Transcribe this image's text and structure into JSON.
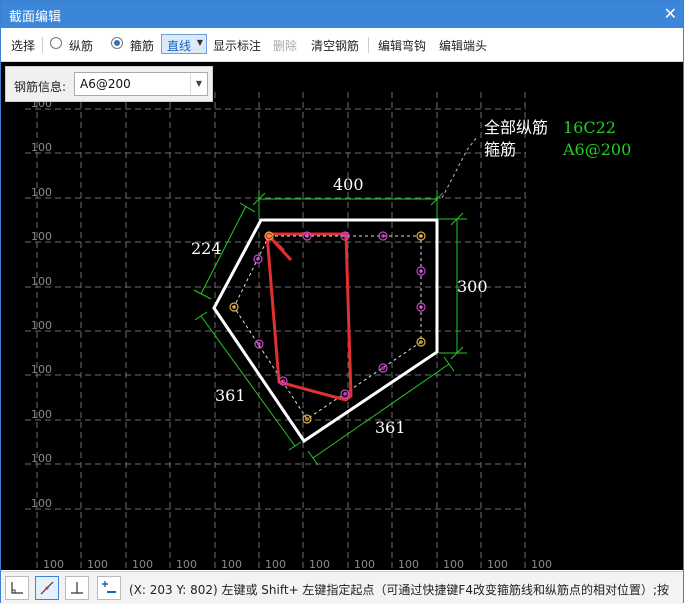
{
  "window": {
    "title": "截面编辑",
    "close_glyph": "✕"
  },
  "toolbar": {
    "select": "选择",
    "longitudinal_radio": "纵筋",
    "stirrup_radio": "箍筋",
    "line_mode": "直线",
    "show_labels": "显示标注",
    "delete": "删除",
    "clear_rebar": "清空钢筋",
    "edit_hook": "编辑弯钩",
    "edit_end": "编辑端头"
  },
  "info_panel": {
    "label": "钢筋信息:",
    "value": "A6@200"
  },
  "drawing": {
    "grid_label": "100",
    "legend_longitudinal_label": "全部纵筋",
    "legend_longitudinal_value": "16C22",
    "legend_stirrup_label": "箍筋",
    "legend_stirrup_value": "A6@200",
    "dim_top": "400",
    "dim_left_upper": "224",
    "dim_right": "300",
    "dim_left_lower": "361",
    "dim_bottom": "361",
    "colors": {
      "section": "#ffffff",
      "dimension": "#22cc22",
      "stirrup": "#e03030",
      "rebar": "#cc44cc",
      "corner_rebar": "#e0b040",
      "legend_value": "#22cc22",
      "grid": "#6e6e6e"
    }
  },
  "statusbar": {
    "text": "(X: 203 Y: 802)  左键或 Shift+ 左键指定起点（可通过快捷键F4改变箍筋线和纵筋点的相对位置）;按"
  }
}
